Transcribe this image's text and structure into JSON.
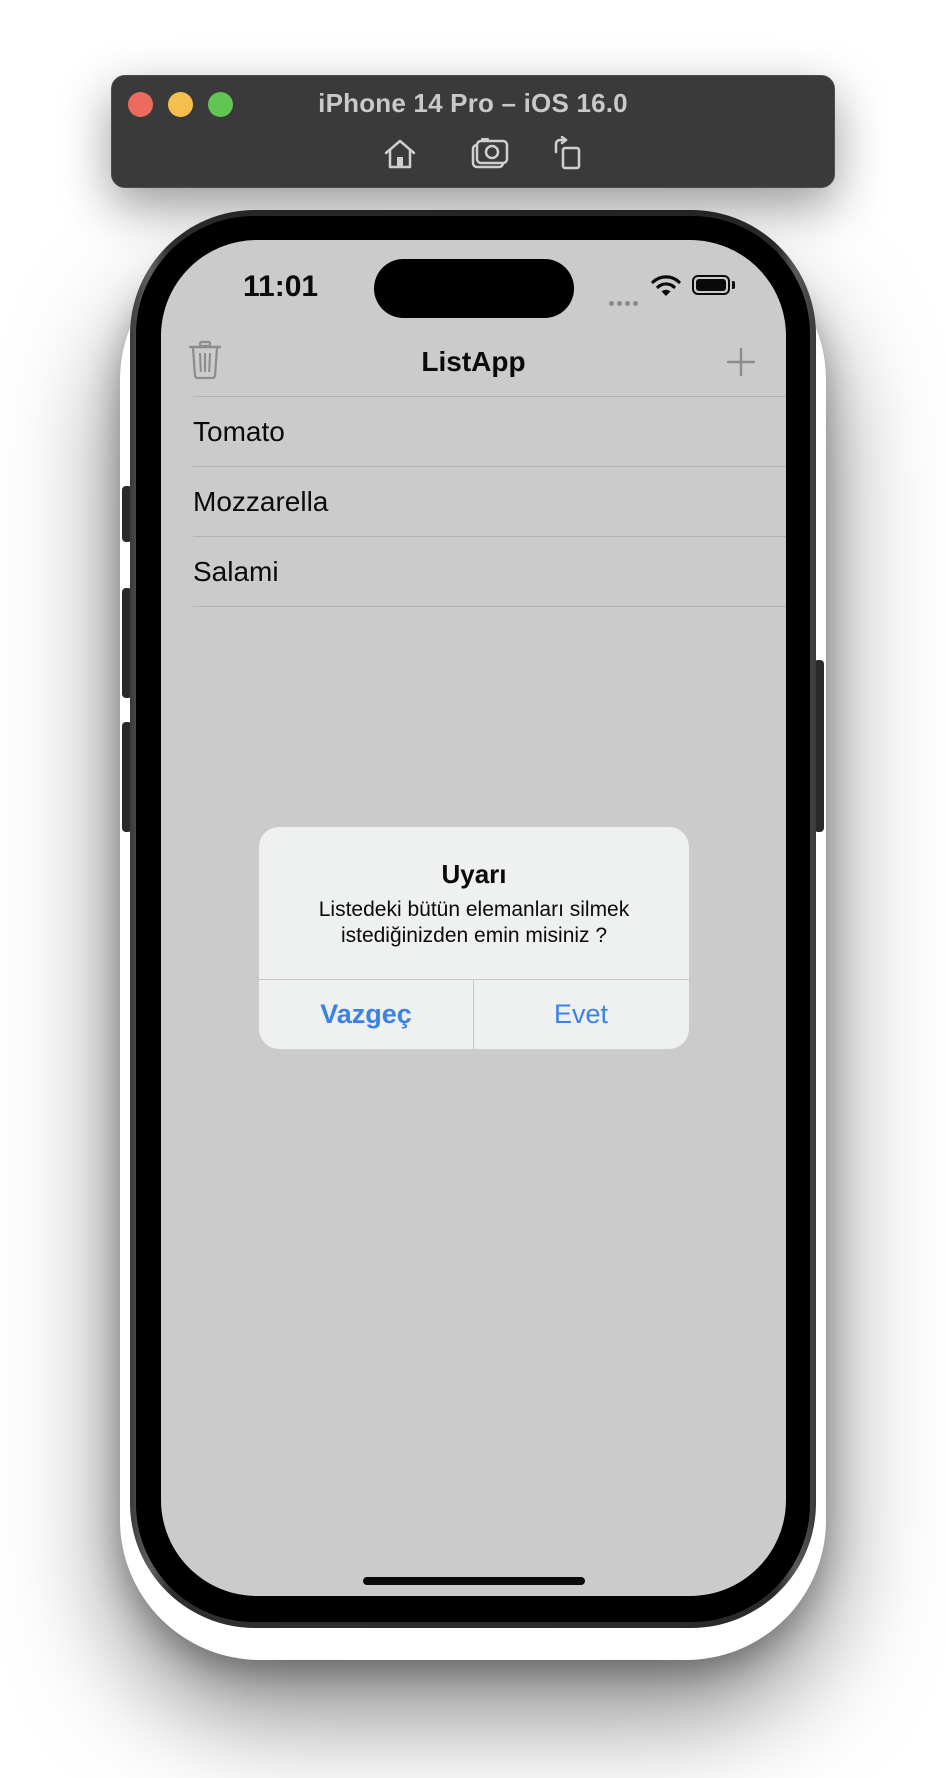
{
  "simulator": {
    "title": "iPhone 14 Pro – iOS 16.0",
    "toolbar": [
      "home-icon",
      "screenshot-icon",
      "rotate-icon"
    ]
  },
  "status_bar": {
    "time": "11:01"
  },
  "nav": {
    "title": "ListApp",
    "left_icon": "trash-icon",
    "right_icon": "plus-icon"
  },
  "list": {
    "items": [
      {
        "label": "Tomato"
      },
      {
        "label": "Mozzarella"
      },
      {
        "label": "Salami"
      }
    ]
  },
  "alert": {
    "title": "Uyarı",
    "message_line1": "Listedeki bütün elemanları silmek",
    "message_line2": "istediğinizden emin misiniz ?",
    "cancel_label": "Vazgeç",
    "confirm_label": "Evet"
  },
  "colors": {
    "dimmed_background": "#cbcbcb",
    "alert_background": "#eff0f0",
    "accent": "#3b82e6",
    "titlebar": "#3a3a3a"
  }
}
